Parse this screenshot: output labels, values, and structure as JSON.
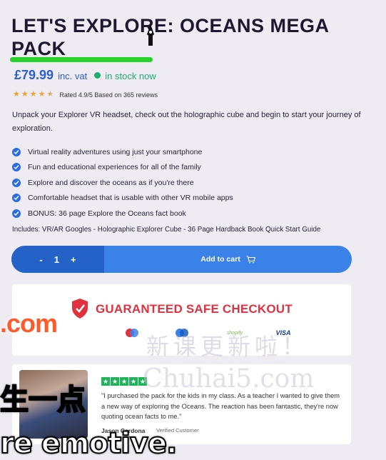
{
  "product": {
    "title": "LET'S EXPLORE: OCEANS MEGA PACK",
    "price": "£79.99",
    "vat": "inc. vat",
    "stock": "in stock now",
    "rating_text": "Rated 4.9/5 Based on 365 reviews",
    "rating": 4.5,
    "description": "Unpack your Explorer VR headset, check out the holographic cube and begin to start your journey of exploration.",
    "features": [
      "Virtual reality adventures using just your smartphone",
      "Fun and educational experiences for all of the family",
      "Explore and discover the oceans as if you're there",
      "Comfortable headset that is usable with other VR mobile apps",
      "BONUS: 36 page Explore the Oceans fact book"
    ],
    "includes": "Includes: VR/AR Googles - Holographic Explorer Cube - 36 Page Hardback Book Quick Start Guide"
  },
  "cart": {
    "minus": "-",
    "quantity": "1",
    "plus": "+",
    "add_label": "Add to cart"
  },
  "checkout": {
    "title": "GUARANTEED SAFE CHECKOUT",
    "logos": [
      "maestro",
      "Cirrus",
      "shopify",
      "VISA"
    ]
  },
  "review": {
    "quote": "\"I purchased the pack for the kids in my class. As a teacher I wanted to give them a new way of exploring the Oceans. The reaction has been fantastic, they're now quoting ocean facts to me.\"",
    "name": "Jason Cardona",
    "badge": "Verified Customer",
    "stars": 5
  },
  "overlays": {
    "watermark_com": ".com",
    "watermark_cn": "新课更新啦！",
    "watermark_site": "Chuhai5.com",
    "subtitle_cn": "生一点",
    "subtitle_en": "re emotive."
  },
  "colors": {
    "accent_blue": "#3a82e8",
    "stock_green": "#1fae6e",
    "checkout_red": "#e0313e",
    "star_orange": "#f0a12b"
  }
}
